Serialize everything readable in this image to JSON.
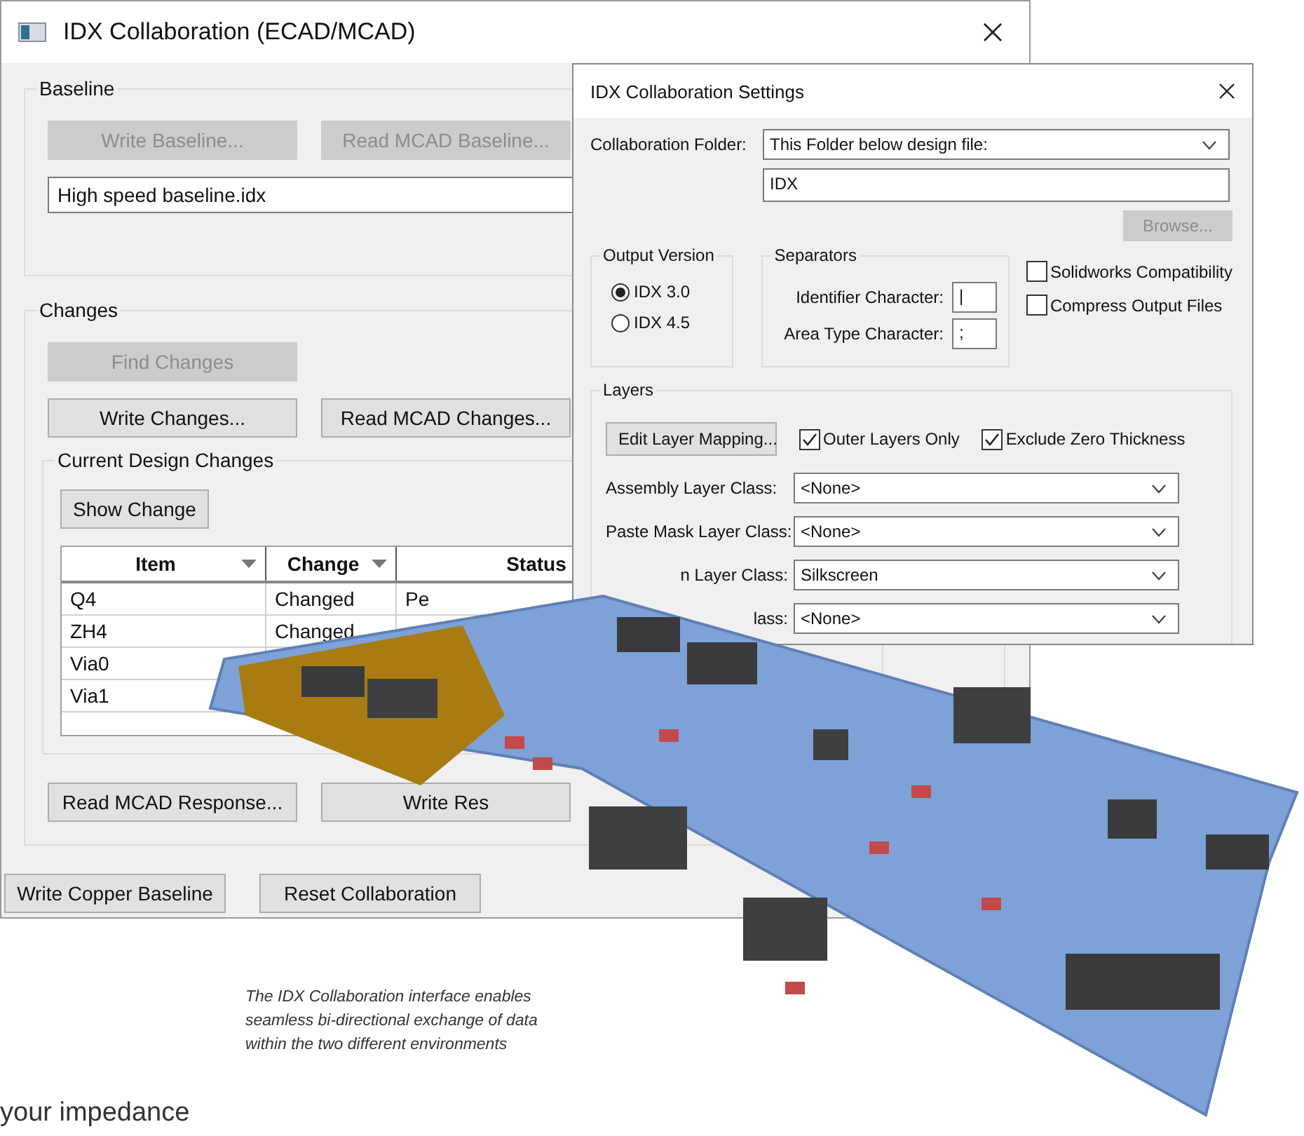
{
  "main_window": {
    "title": "IDX Collaboration (ECAD/MCAD)",
    "baseline": {
      "label": "Baseline",
      "buttons": [
        {
          "label": "Write Baseline...",
          "disabled": true
        },
        {
          "label": "Read MCAD Baseline...",
          "disabled": true
        }
      ],
      "file": "High speed baseline.idx"
    },
    "changes": {
      "label": "Changes",
      "find_button": {
        "label": "Find Changes",
        "disabled": true
      },
      "buttons": [
        {
          "label": "Write Changes...",
          "disabled": false
        },
        {
          "label": "Read MCAD Changes...",
          "disabled": false
        }
      ]
    },
    "current_design_changes": {
      "label": "Current Design Changes",
      "show_button": "Show Change",
      "table": {
        "columns": [
          {
            "label": "Item",
            "filter": true
          },
          {
            "label": "Change",
            "filter": true
          },
          {
            "label": "Status"
          }
        ],
        "rows": [
          [
            "Q4",
            "Changed",
            "Pe"
          ],
          [
            "ZH4",
            "Changed",
            ""
          ],
          [
            "Via0",
            "",
            ""
          ],
          [
            "Via1",
            "",
            ""
          ]
        ]
      }
    },
    "response_buttons": [
      "Read MCAD Response...",
      "Write Res"
    ],
    "footer_buttons": [
      "Write Copper Baseline",
      "Reset Collaboration"
    ]
  },
  "settings_window": {
    "title": "IDX Collaboration Settings",
    "collaboration_folder": {
      "label": "Collaboration Folder:",
      "value": "This Folder below design file:"
    },
    "folder_name": "IDX",
    "browse_button": {
      "label": "Browse...",
      "disabled": true
    },
    "output_version": {
      "label": "Output Version",
      "options": [
        {
          "label": "IDX 3.0",
          "selected": true
        },
        {
          "label": "IDX 4.5",
          "selected": false
        }
      ]
    },
    "separators": {
      "label": "Separators",
      "fields": [
        {
          "label": "Identifier Character:",
          "value": "|"
        },
        {
          "label": "Area Type Character:",
          "value": ";"
        }
      ]
    },
    "options": [
      {
        "label": "Solidworks Compatibility",
        "checked": false
      },
      {
        "label": "Compress Output Files",
        "checked": false
      }
    ],
    "layers": {
      "label": "Layers",
      "edit_button": "Edit Layer Mapping...",
      "checkboxes": [
        {
          "label": "Outer Layers Only",
          "checked": true
        },
        {
          "label": "Exclude Zero Thickness",
          "checked": true
        }
      ],
      "classes": [
        {
          "label": "Assembly Layer Class:",
          "value": "<None>"
        },
        {
          "label": "Paste Mask Layer Class:",
          "value": "<None>"
        },
        {
          "label": "n Layer Class:",
          "value": "Silkscreen",
          "kind": "partial"
        },
        {
          "label": "lass:",
          "value": "<None>",
          "kind": "partial"
        }
      ]
    }
  },
  "caption": "The IDX Collaboration interface enables seamless bi-directional exchange of  data within the two different environments",
  "body_text": "your impedance"
}
